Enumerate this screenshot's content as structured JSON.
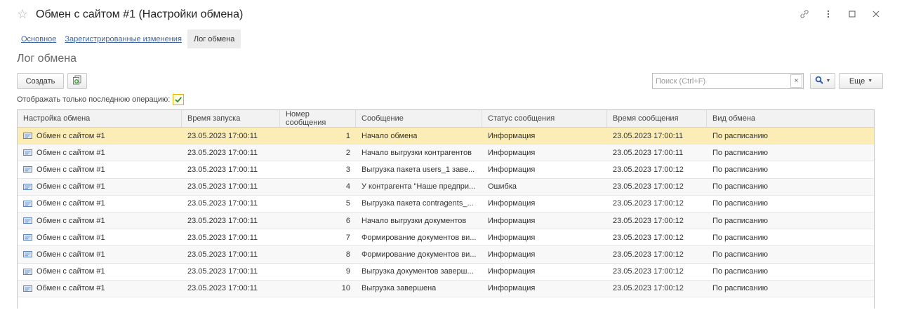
{
  "window": {
    "title": "Обмен с сайтом #1 (Настройки обмена)",
    "controls": [
      "link-icon",
      "more-vertical-icon",
      "maximize-icon",
      "close-icon"
    ]
  },
  "tabs": [
    {
      "label": "Основное",
      "active": false
    },
    {
      "label": "Зарегистрированные изменения",
      "active": false
    },
    {
      "label": "Лог обмена",
      "active": true
    }
  ],
  "section_title": "Лог обмена",
  "toolbar": {
    "create_label": "Создать",
    "copy_icon": "copy-icon",
    "search_placeholder": "Поиск (Ctrl+F)",
    "clear_label": "×",
    "more_label": "Еще"
  },
  "filter": {
    "label": "Отображать только последнюю операцию:",
    "checked": true
  },
  "table": {
    "columns": [
      "Настройка обмена",
      "Время запуска",
      "Номер сообщения",
      "Сообщение",
      "Статус сообщения",
      "Время сообщения",
      "Вид обмена"
    ],
    "rows": [
      {
        "setting": "Обмен с сайтом #1",
        "start": "23.05.2023 17:00:11",
        "num": "1",
        "message": "Начало обмена",
        "status": "Информация",
        "msg_time": "23.05.2023 17:00:11",
        "kind": "По расписанию"
      },
      {
        "setting": "Обмен с сайтом #1",
        "start": "23.05.2023 17:00:11",
        "num": "2",
        "message": "Начало выгрузки контрагентов",
        "status": "Информация",
        "msg_time": "23.05.2023 17:00:11",
        "kind": "По расписанию"
      },
      {
        "setting": "Обмен с сайтом #1",
        "start": "23.05.2023 17:00:11",
        "num": "3",
        "message": "Выгрузка пакета users_1 заве...",
        "status": "Информация",
        "msg_time": "23.05.2023 17:00:12",
        "kind": "По расписанию"
      },
      {
        "setting": "Обмен с сайтом #1",
        "start": "23.05.2023 17:00:11",
        "num": "4",
        "message": "У контрагента \"Наше предпри...",
        "status": "Ошибка",
        "msg_time": "23.05.2023 17:00:12",
        "kind": "По расписанию"
      },
      {
        "setting": "Обмен с сайтом #1",
        "start": "23.05.2023 17:00:11",
        "num": "5",
        "message": "Выгрузка пакета contragents_...",
        "status": "Информация",
        "msg_time": "23.05.2023 17:00:12",
        "kind": "По расписанию"
      },
      {
        "setting": "Обмен с сайтом #1",
        "start": "23.05.2023 17:00:11",
        "num": "6",
        "message": "Начало выгрузки документов",
        "status": "Информация",
        "msg_time": "23.05.2023 17:00:12",
        "kind": "По расписанию"
      },
      {
        "setting": "Обмен с сайтом #1",
        "start": "23.05.2023 17:00:11",
        "num": "7",
        "message": "Формирование документов ви...",
        "status": "Информация",
        "msg_time": "23.05.2023 17:00:12",
        "kind": "По расписанию"
      },
      {
        "setting": "Обмен с сайтом #1",
        "start": "23.05.2023 17:00:11",
        "num": "8",
        "message": "Формирование документов ви...",
        "status": "Информация",
        "msg_time": "23.05.2023 17:00:12",
        "kind": "По расписанию"
      },
      {
        "setting": "Обмен с сайтом #1",
        "start": "23.05.2023 17:00:11",
        "num": "9",
        "message": "Выгрузка документов заверш...",
        "status": "Информация",
        "msg_time": "23.05.2023 17:00:12",
        "kind": "По расписанию"
      },
      {
        "setting": "Обмен с сайтом #1",
        "start": "23.05.2023 17:00:11",
        "num": "10",
        "message": "Выгрузка завершена",
        "status": "Информация",
        "msg_time": "23.05.2023 17:00:12",
        "kind": "По расписанию"
      }
    ],
    "selected_row": 0,
    "colors": {
      "selected": "#fbedb5",
      "alt": "#f8f8f8"
    }
  }
}
